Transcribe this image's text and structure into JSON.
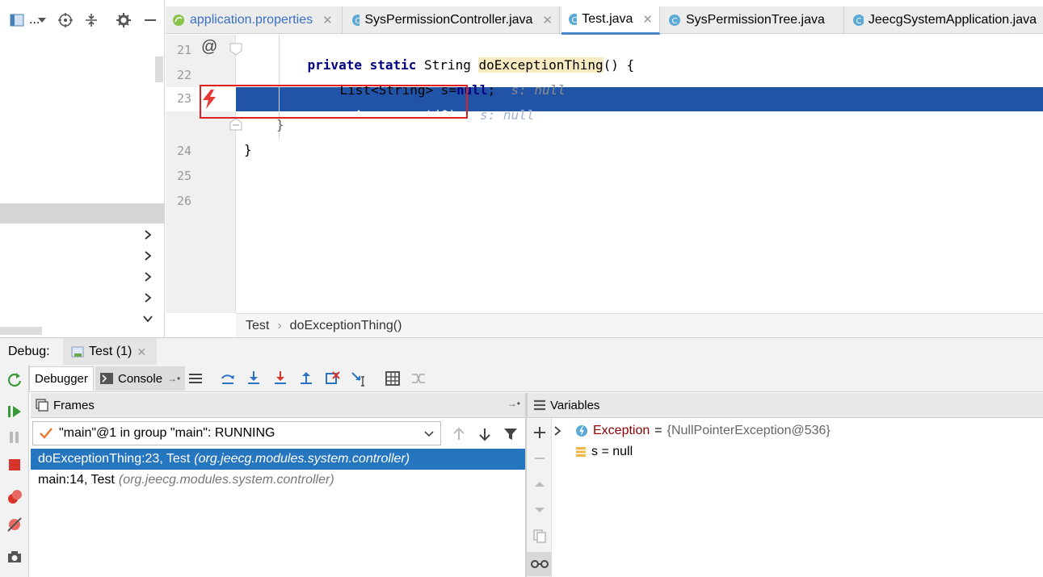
{
  "tabs": [
    {
      "label": "application.properties",
      "icon": "properties-file-icon",
      "active": false,
      "color": "#3a6fc4",
      "closable": true
    },
    {
      "label": "SysPermissionController.java",
      "icon": "java-class-icon",
      "active": false,
      "closable": true
    },
    {
      "label": "Test.java",
      "icon": "java-class-icon",
      "active": true,
      "closable": true
    },
    {
      "label": "SysPermissionTree.java",
      "icon": "java-class-icon",
      "active": false,
      "closable": true
    },
    {
      "label": "JeecgSystemApplication.java",
      "icon": "java-class-icon",
      "active": false,
      "closable": false
    }
  ],
  "sidebar": {
    "toolbar_label": "..."
  },
  "editor": {
    "line_numbers": [
      "21",
      "22",
      "23",
      "24",
      "25",
      "26"
    ],
    "lines": {
      "l21_kw": "private static",
      "l21_type": "String",
      "l21_method": "doExceptionThing",
      "l21_rest": "() {",
      "l22_code": "List<String> s=",
      "l22_null": "null",
      "l22_semi": ";",
      "l22_hint": "s: null",
      "l23_kw": "return",
      "l23_code": "s.get(0);",
      "l23_hint": "s: null",
      "l24": "}",
      "l25": "}"
    },
    "gutter_marker_21": "@"
  },
  "breadcrumb": {
    "class": "Test",
    "method": "doExceptionThing()"
  },
  "debug": {
    "label": "Debug:",
    "session_tab": "Test (1)",
    "tab_debugger": "Debugger",
    "tab_console": "Console",
    "frames_title": "Frames",
    "variables_title": "Variables",
    "thread": "\"main\"@1 in group \"main\": RUNNING",
    "frames": [
      {
        "method": "doExceptionThing:23, Test",
        "package": "(org.jeecg.modules.system.controller)",
        "selected": true
      },
      {
        "method": "main:14, Test",
        "package": "(org.jeecg.modules.system.controller)",
        "selected": false
      }
    ],
    "variables": [
      {
        "name": "Exception",
        "eq": "=",
        "value": "{NullPointerException@536}",
        "expandable": true
      },
      {
        "name": "s = null",
        "eq": "",
        "value": "",
        "expandable": false
      }
    ]
  },
  "colors": {
    "selection": "#2154a6",
    "frame_selection": "#2675bf",
    "error_box": "#e02020",
    "keyword": "#000080"
  }
}
